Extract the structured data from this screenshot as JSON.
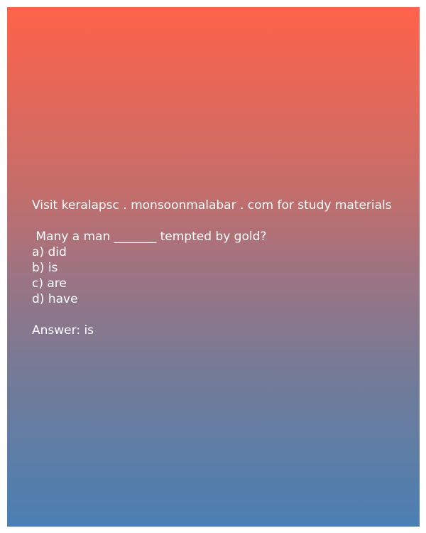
{
  "promo": "Visit keralapsc . monsoonmalabar . com for study materials",
  "question": " Many a man _______ tempted by gold?",
  "options": [
    "a) did",
    "b) is",
    "c) are",
    "d) have"
  ],
  "answer": "Answer: is"
}
